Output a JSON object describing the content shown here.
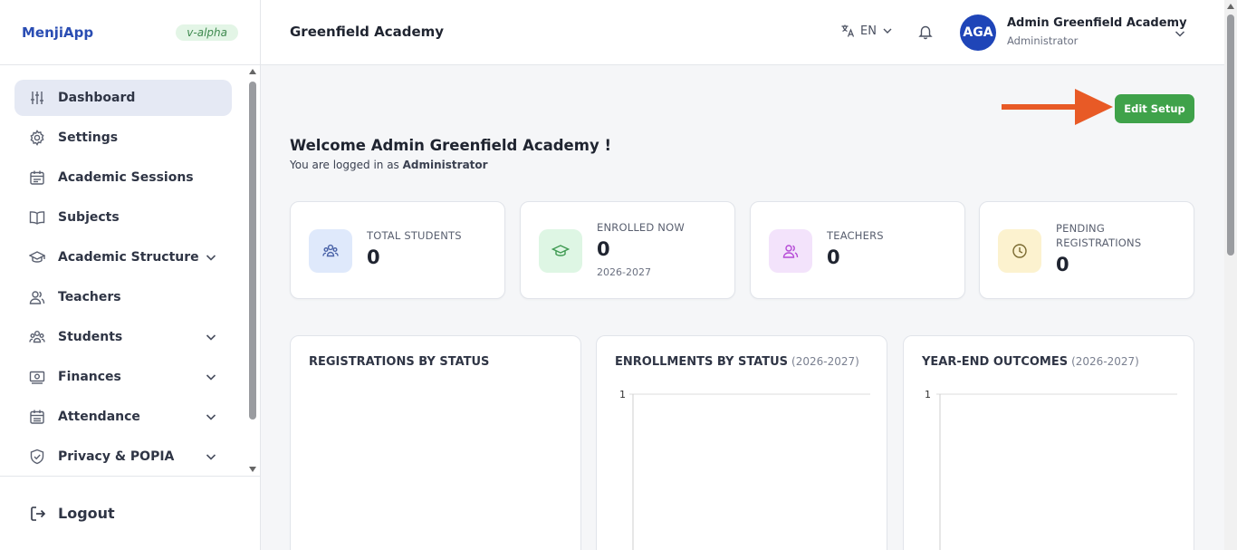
{
  "app": {
    "name": "MenjiApp",
    "version": "v-alpha"
  },
  "sidebar": {
    "items": [
      {
        "label": "Dashboard",
        "icon": "sliders-icon",
        "active": true,
        "expandable": false
      },
      {
        "label": "Settings",
        "icon": "gear-icon",
        "active": false,
        "expandable": false
      },
      {
        "label": "Academic Sessions",
        "icon": "calendar-icon",
        "active": false,
        "expandable": false
      },
      {
        "label": "Subjects",
        "icon": "book-icon",
        "active": false,
        "expandable": false
      },
      {
        "label": "Academic Structure",
        "icon": "graduation-cap-icon",
        "active": false,
        "expandable": true
      },
      {
        "label": "Teachers",
        "icon": "users-icon",
        "active": false,
        "expandable": false
      },
      {
        "label": "Students",
        "icon": "group-icon",
        "active": false,
        "expandable": true
      },
      {
        "label": "Finances",
        "icon": "cash-icon",
        "active": false,
        "expandable": true
      },
      {
        "label": "Attendance",
        "icon": "calendar-check-icon",
        "active": false,
        "expandable": true
      },
      {
        "label": "Privacy & POPIA",
        "icon": "shield-icon",
        "active": false,
        "expandable": true
      }
    ],
    "logout_label": "Logout"
  },
  "header": {
    "title": "Greenfield Academy",
    "language": "EN",
    "user": {
      "initials": "AGA",
      "name": "Admin Greenfield Academy",
      "role": "Administrator"
    }
  },
  "main": {
    "edit_setup_label": "Edit Setup",
    "welcome": "Welcome Admin Greenfield Academy !",
    "logged_in_prefix": "You are logged in as",
    "logged_in_role": "Administrator",
    "stats": [
      {
        "label": "TOTAL STUDENTS",
        "value": "0",
        "sub": "",
        "icon": "students-icon",
        "color": "#dfe9fb"
      },
      {
        "label": "ENROLLED NOW",
        "value": "0",
        "sub": "2026-2027",
        "icon": "graduation-cap-icon",
        "color": "#def6e4"
      },
      {
        "label": "TEACHERS",
        "value": "0",
        "sub": "",
        "icon": "teachers-icon",
        "color": "#f3e3fb"
      },
      {
        "label": "PENDING REGISTRATIONS",
        "label_line1": "PENDING",
        "label_line2": "REGISTRATIONS",
        "value": "0",
        "sub": "",
        "icon": "clock-icon",
        "color": "#fcf2cf"
      }
    ],
    "charts": [
      {
        "title": "REGISTRATIONS BY STATUS",
        "period": ""
      },
      {
        "title": "ENROLLMENTS BY STATUS",
        "period": "(2026-2027)"
      },
      {
        "title": "YEAR-END OUTCOMES",
        "period": "(2026-2027)"
      }
    ]
  },
  "chart_data": [
    {
      "type": "bar",
      "title": "REGISTRATIONS BY STATUS",
      "categories": [],
      "values": []
    },
    {
      "type": "bar",
      "title": "ENROLLMENTS BY STATUS",
      "categories": [],
      "values": [],
      "ylim": [
        0,
        1
      ],
      "yticks": [
        "1"
      ]
    },
    {
      "type": "bar",
      "title": "YEAR-END OUTCOMES",
      "categories": [],
      "values": [],
      "ylim": [
        0,
        1
      ],
      "yticks": [
        "1"
      ]
    }
  ],
  "colors": {
    "accent": "#2a4db3",
    "button": "#3fa24a",
    "arrow": "#e85a26"
  }
}
